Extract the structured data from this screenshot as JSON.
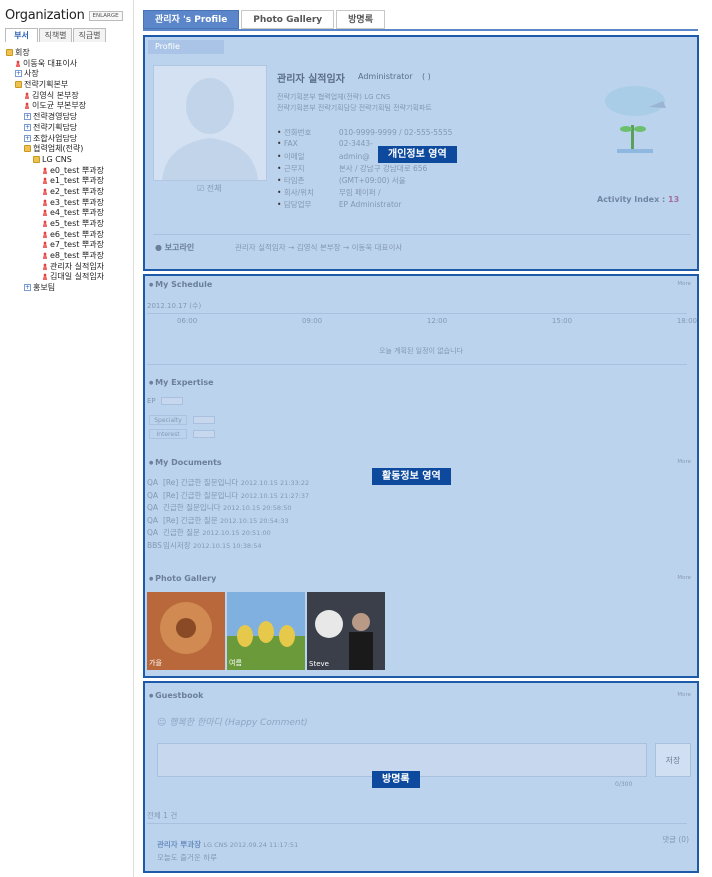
{
  "sidebar": {
    "title": "Organization",
    "enlarge": "ENLARGE",
    "tabs": [
      "부서",
      "직책별",
      "직급별"
    ],
    "tree": [
      {
        "label": "회장",
        "kind": "folder",
        "depth": 0
      },
      {
        "label": "이동욱 대표이사",
        "kind": "person",
        "depth": 1
      },
      {
        "label": "사장",
        "kind": "plus",
        "depth": 1
      },
      {
        "label": "전략기획본부",
        "kind": "folder",
        "depth": 1
      },
      {
        "label": "김영식 본부장",
        "kind": "person",
        "depth": 2
      },
      {
        "label": "이도균 부본부장",
        "kind": "person",
        "depth": 2
      },
      {
        "label": "전략경영담당",
        "kind": "plus",
        "depth": 2
      },
      {
        "label": "전략기획담당",
        "kind": "plus",
        "depth": 2
      },
      {
        "label": "조합사업담당",
        "kind": "plus",
        "depth": 2
      },
      {
        "label": "협력업체(전략)",
        "kind": "folder",
        "depth": 2
      },
      {
        "label": "LG CNS",
        "kind": "folder",
        "depth": 3
      },
      {
        "label": "e0_test 뿌과장",
        "kind": "person",
        "depth": 4
      },
      {
        "label": "e1_test 뿌과장",
        "kind": "person",
        "depth": 4
      },
      {
        "label": "e2_test 뿌과장",
        "kind": "person",
        "depth": 4
      },
      {
        "label": "e3_test 뿌과장",
        "kind": "person",
        "depth": 4
      },
      {
        "label": "e4_test 뿌과장",
        "kind": "person",
        "depth": 4
      },
      {
        "label": "e5_test 뿌과장",
        "kind": "person",
        "depth": 4
      },
      {
        "label": "e6_test 뿌과장",
        "kind": "person",
        "depth": 4
      },
      {
        "label": "e7_test 뿌과장",
        "kind": "person",
        "depth": 4
      },
      {
        "label": "e8_test 뿌과장",
        "kind": "person",
        "depth": 4
      },
      {
        "label": "관리자 실적임자",
        "kind": "person",
        "depth": 4
      },
      {
        "label": "김대일 실적임자",
        "kind": "person",
        "depth": 4
      },
      {
        "label": "홍보팀",
        "kind": "plus",
        "depth": 2
      }
    ]
  },
  "tabs": [
    "관리자 's Profile",
    "Photo Gallery",
    "방명록"
  ],
  "profile": {
    "badge": "개인정보 영역",
    "tab": "Profile",
    "name": "관리자 실적임자",
    "role": "Administrator",
    "paren": "( )",
    "dept1": "전략기획본부 협력업체(전략) LG CNS",
    "dept2": "전략기획본부 전략기획담당 전략기획팀 전략기획파트",
    "phone_label": "전화번호",
    "phone": "010-9999-9999 / 02-555-5555",
    "fax_label": "FAX",
    "fax": "02-3443-",
    "email_label": "이메일",
    "email": "admin@",
    "place_label": "근무지",
    "place": "본사 / 강남구 강남대로 656",
    "tz_label": "타임존",
    "tz": "(GMT+09:00) 서울",
    "office_label": "회사/위치",
    "office": "무림 페이퍼 /",
    "duty_label": "담당업무",
    "duty": "EP Administrator",
    "all_label": "전체",
    "activity_label": "Activity Index :",
    "activity_value": "13",
    "report_label": "보고라인",
    "report_line": "관리자 실적임자 → 김영식 본부장 → 이동욱 대표이사"
  },
  "activity": {
    "badge": "활동정보 영역",
    "schedule_title": "My Schedule",
    "more": "More",
    "schedule_date": "2012.10.17 (수)",
    "hours": [
      "06:00",
      "09:00",
      "12:00",
      "15:00",
      "18:00"
    ],
    "no_schedule": "오늘 계획된 일정이 없습니다",
    "expertise_title": "My Expertise",
    "expertise_ep": "EP",
    "specialty": "Specialty",
    "interest": "Interest",
    "documents_title": "My Documents",
    "documents": [
      {
        "tag": "QA",
        "title": "[Re] 긴급한 질문입니다",
        "date": "2012.10.15 21:33:22"
      },
      {
        "tag": "QA",
        "title": "[Re] 긴급한 질문입니다",
        "date": "2012.10.15 21:27:37"
      },
      {
        "tag": "QA",
        "title": "긴급한 질문입니다",
        "date": "2012.10.15 20:58:50"
      },
      {
        "tag": "QA",
        "title": "[Re] 긴급한 질문",
        "date": "2012.10.15 20:54:33"
      },
      {
        "tag": "QA",
        "title": "긴급한 질문",
        "date": "2012.10.15 20:51:00"
      },
      {
        "tag": "BBS",
        "title": "임시저장",
        "date": "2012.10.15 10:38:54"
      }
    ],
    "gallery_title": "Photo Gallery",
    "photos": [
      {
        "caption": "가을",
        "color": "#b8683a"
      },
      {
        "caption": "여름",
        "color": "#c9b046"
      },
      {
        "caption": "Steve",
        "color": "#3a3f4a"
      }
    ]
  },
  "guestbook": {
    "badge": "방명록",
    "title": "Guestbook",
    "more": "More",
    "happy": "행복한 한마디 (Happy Comment)",
    "save": "저장",
    "counter": "0/300",
    "total": "전체 1 건",
    "author": "관리자 뿌과장",
    "meta": "LG CNS 2012.09.24 11:17:51",
    "reply": "댓글 (0)",
    "entry": "오늘도 즐거운 하루"
  }
}
